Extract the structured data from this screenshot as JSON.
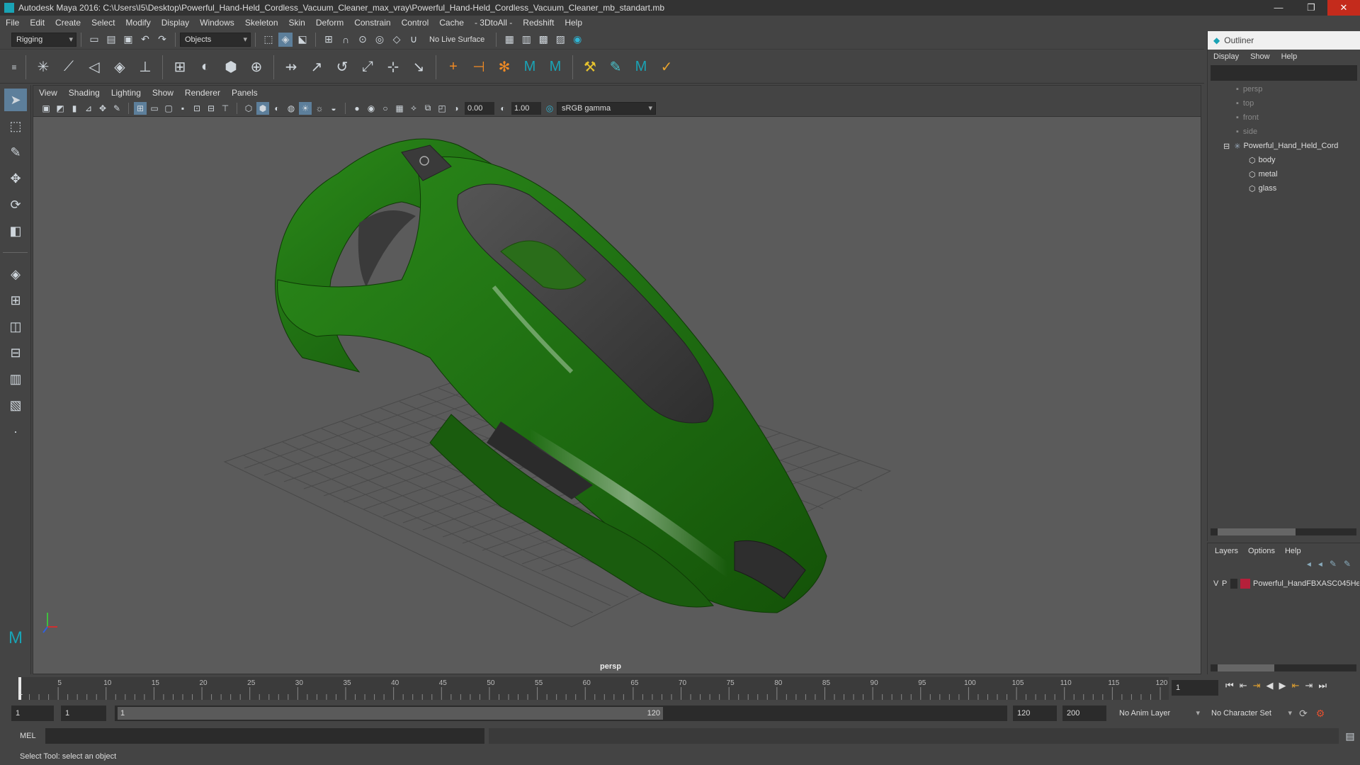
{
  "window": {
    "title": "Autodesk Maya 2016: C:\\Users\\I5\\Desktop\\Powerful_Hand-Held_Cordless_Vacuum_Cleaner_max_vray\\Powerful_Hand-Held_Cordless_Vacuum_Cleaner_mb_standart.mb"
  },
  "menubar": [
    "File",
    "Edit",
    "Create",
    "Select",
    "Modify",
    "Display",
    "Windows",
    "Skeleton",
    "Skin",
    "Deform",
    "Constrain",
    "Control",
    "Cache",
    "- 3DtoAll -",
    "Redshift",
    "Help"
  ],
  "statusline": {
    "mode": "Rigging",
    "selection_mask": "Objects",
    "live_surface": "No Live Surface"
  },
  "viewport_menu": [
    "View",
    "Shading",
    "Lighting",
    "Show",
    "Renderer",
    "Panels"
  ],
  "viewport_toolbar": {
    "exposure": "0.00",
    "gamma": "1.00",
    "color_space": "sRGB gamma"
  },
  "camera_label": "persp",
  "outliner": {
    "title": "Outliner",
    "menu": [
      "Display",
      "Show",
      "Help"
    ],
    "items": [
      {
        "label": "persp",
        "dim": true,
        "indent": 1
      },
      {
        "label": "top",
        "dim": true,
        "indent": 1
      },
      {
        "label": "front",
        "dim": true,
        "indent": 1
      },
      {
        "label": "side",
        "dim": true,
        "indent": 1
      },
      {
        "label": "Powerful_Hand_Held_Cord",
        "dim": false,
        "indent": 0
      },
      {
        "label": "body",
        "dim": false,
        "indent": 2
      },
      {
        "label": "metal",
        "dim": false,
        "indent": 2
      },
      {
        "label": "glass",
        "dim": false,
        "indent": 2
      }
    ]
  },
  "layers": {
    "menu": [
      "Layers",
      "Options",
      "Help"
    ],
    "row": {
      "v": "V",
      "p": "P",
      "name": "Powerful_HandFBXASC045He",
      "color": "#b5203a"
    }
  },
  "timeline": {
    "ticks": [
      "5",
      "10",
      "15",
      "20",
      "25",
      "30",
      "35",
      "40",
      "45",
      "50",
      "55",
      "60",
      "65",
      "70",
      "75",
      "80",
      "85",
      "90",
      "95",
      "100",
      "105",
      "110",
      "115",
      "120"
    ],
    "current_frame_label": "1",
    "current_frame": "1"
  },
  "range": {
    "start": "1",
    "start2": "1",
    "slider_start": "1",
    "slider_end": "120",
    "end": "120",
    "end2": "200",
    "anim_layer": "No Anim Layer",
    "character_set": "No Character Set"
  },
  "command": {
    "label": "MEL"
  },
  "help_line": "Select Tool: select an object",
  "colors": {
    "vacuum_body": "#1f6e12",
    "vacuum_dark": "#3c3c3c",
    "grid": "#4a4a4a"
  }
}
